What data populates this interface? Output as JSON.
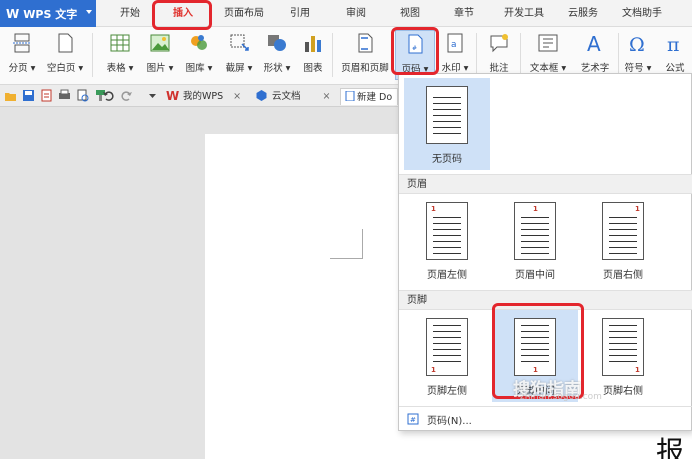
{
  "app": {
    "name": "WPS 文字",
    "logo": "W"
  },
  "menu": {
    "tabs": [
      {
        "label": "开始",
        "active": false
      },
      {
        "label": "插入",
        "active": true
      },
      {
        "label": "页面布局",
        "active": false
      },
      {
        "label": "引用",
        "active": false
      },
      {
        "label": "审阅",
        "active": false
      },
      {
        "label": "视图",
        "active": false
      },
      {
        "label": "章节",
        "active": false
      },
      {
        "label": "开发工具",
        "active": false
      },
      {
        "label": "云服务",
        "active": false
      },
      {
        "label": "文档助手",
        "active": false
      }
    ]
  },
  "ribbon": {
    "tools": [
      {
        "label": "分页 ▾",
        "icon": "page-break-icon"
      },
      {
        "label": "空白页 ▾",
        "icon": "blank-page-icon"
      },
      {
        "label": "表格 ▾",
        "icon": "table-icon"
      },
      {
        "label": "图片 ▾",
        "icon": "picture-icon"
      },
      {
        "label": "图库 ▾",
        "icon": "gallery-icon"
      },
      {
        "label": "截屏 ▾",
        "icon": "screenshot-icon"
      },
      {
        "label": "形状 ▾",
        "icon": "shape-icon"
      },
      {
        "label": "图表",
        "icon": "chart-icon"
      },
      {
        "label": "页眉和页脚",
        "icon": "header-footer-icon"
      },
      {
        "label": "页码 ▾",
        "icon": "page-number-icon"
      },
      {
        "label": "水印 ▾",
        "icon": "watermark-icon"
      },
      {
        "label": "批注",
        "icon": "comment-icon"
      },
      {
        "label": "文本框 ▾",
        "icon": "textbox-icon"
      },
      {
        "label": "艺术字",
        "icon": "wordart-icon"
      },
      {
        "label": "符号 ▾",
        "icon": "symbol-icon"
      },
      {
        "label": "公式",
        "icon": "formula-icon"
      }
    ]
  },
  "tabbar": {
    "tabs": [
      {
        "label": "我的WPS",
        "close": "×"
      },
      {
        "label": "云文档",
        "close": "×"
      },
      {
        "label": "新建 Do",
        "close": ""
      }
    ]
  },
  "dropdown": {
    "no_page_number": "无页码",
    "header_section": "页眉",
    "header_items": [
      "页眉左侧",
      "页眉中间",
      "页眉右侧"
    ],
    "footer_section": "页脚",
    "footer_items": [
      "页脚左侧",
      "页脚中间",
      "页脚右侧"
    ],
    "page_number_menu": "页码(N)...",
    "thumb_number": "1"
  },
  "document": {
    "trailing_char": "报"
  },
  "watermark": {
    "text": "搜狗指南",
    "url": "zhinan.sogou.com"
  },
  "colors": {
    "accent": "#2f6fd0",
    "highlight_red": "#e3262d",
    "selected_bg": "#cfe1f7"
  }
}
